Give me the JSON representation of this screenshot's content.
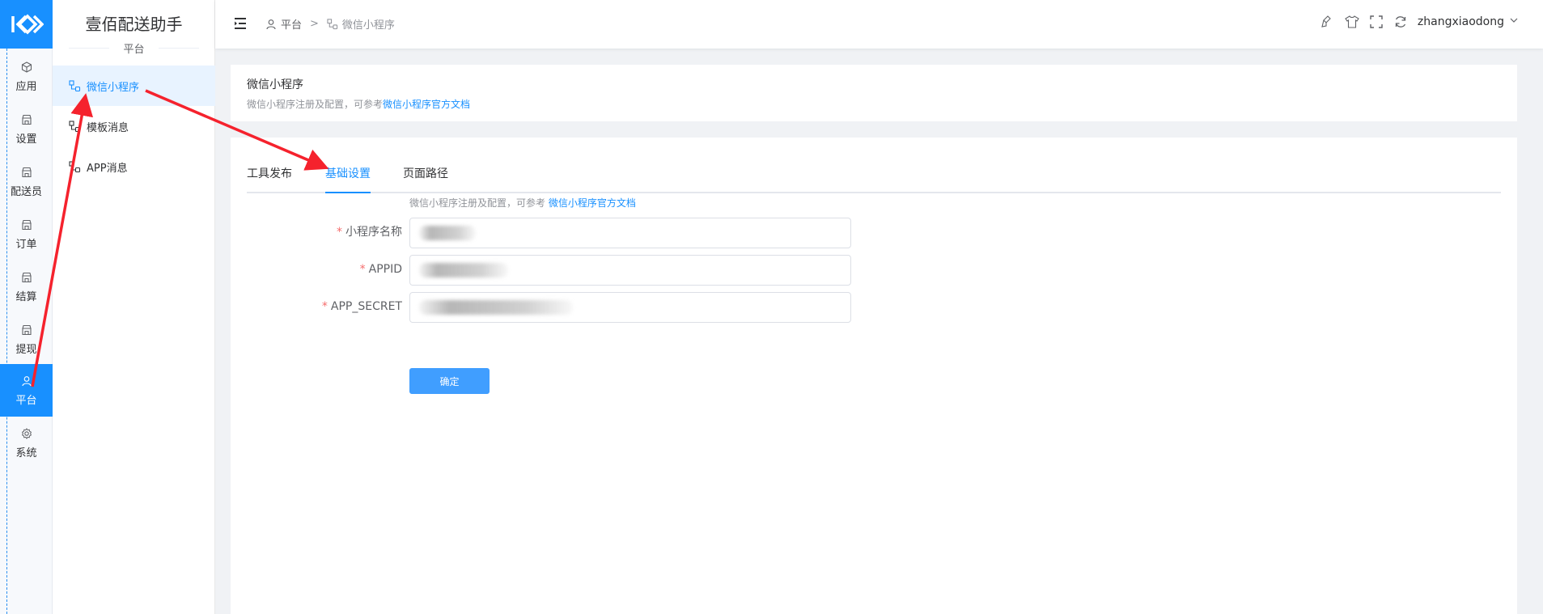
{
  "app": {
    "title": "壹佰配送助手",
    "section": "平台"
  },
  "rail": {
    "items": [
      {
        "label": "应用",
        "icon": "cube-icon"
      },
      {
        "label": "设置",
        "icon": "store-icon"
      },
      {
        "label": "配送员",
        "icon": "store-icon"
      },
      {
        "label": "订单",
        "icon": "store-icon"
      },
      {
        "label": "结算",
        "icon": "store-icon"
      },
      {
        "label": "提现",
        "icon": "store-icon"
      },
      {
        "label": "平台",
        "icon": "user-icon",
        "active": true
      },
      {
        "label": "系统",
        "icon": "gear-icon"
      }
    ]
  },
  "submenu": {
    "items": [
      {
        "label": "微信小程序",
        "active": true
      },
      {
        "label": "模板消息"
      },
      {
        "label": "APP消息"
      }
    ]
  },
  "header": {
    "breadcrumb": [
      "平台",
      "微信小程序"
    ],
    "separator": ">",
    "username": "zhangxiaodong"
  },
  "info_card": {
    "title": "微信小程序",
    "desc": "微信小程序注册及配置，可参考",
    "link": "微信小程序官方文档"
  },
  "tabs": [
    "工具发布",
    "基础设置",
    "页面路径"
  ],
  "active_tab": "基础设置",
  "form": {
    "hint": "微信小程序注册及配置，可参考",
    "hint_link": "微信小程序官方文档",
    "fields": [
      {
        "label": "小程序名称",
        "value": ""
      },
      {
        "label": "APPID",
        "value": ""
      },
      {
        "label": "APP_SECRET",
        "value": ""
      }
    ],
    "submit": "确定"
  },
  "colors": {
    "primary": "#1890ff",
    "button": "#409eff",
    "annotation": "#f5222d"
  }
}
